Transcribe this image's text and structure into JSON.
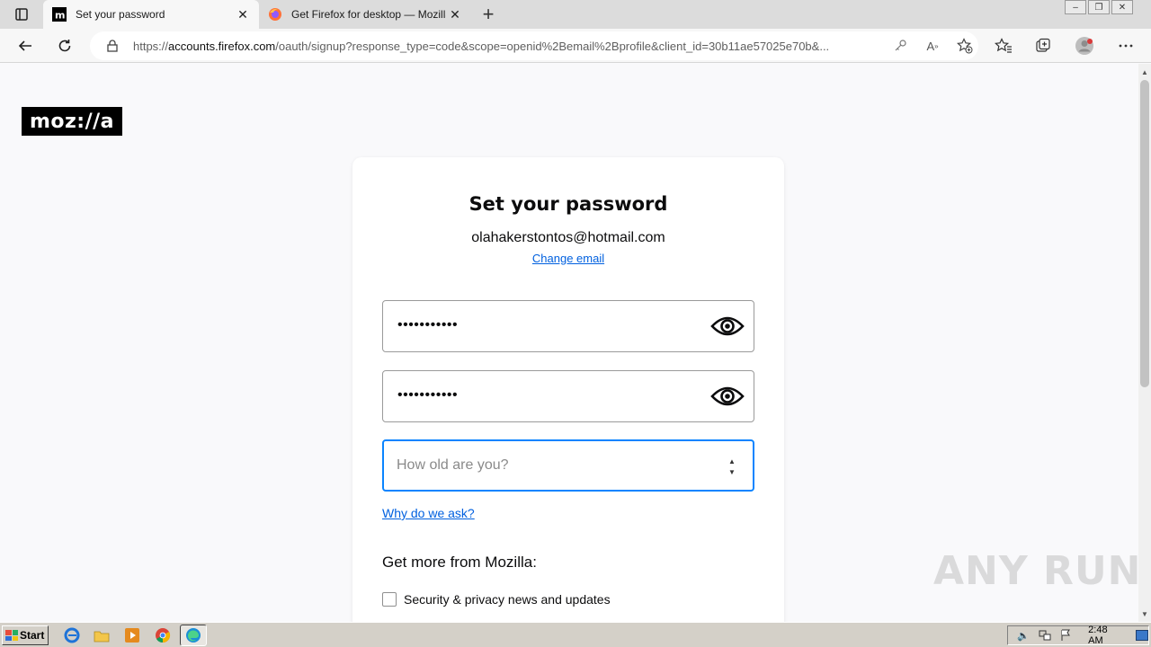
{
  "browser": {
    "tabs": [
      {
        "title": "Set your password",
        "favicon": "mozilla-m-icon",
        "active": true
      },
      {
        "title": "Get Firefox for desktop — Mozilla",
        "favicon": "firefox-icon",
        "active": false
      }
    ],
    "address": {
      "url_scheme": "https://",
      "url_host": "accounts.firefox.com",
      "url_path": "/oauth/signup?response_type=code&scope=openid%2Bemail%2Bprofile&client_id=30b11ae57025e70b&..."
    }
  },
  "page": {
    "logo_text": "moz://a",
    "heading": "Set your password",
    "email": "olahakerstontos@hotmail.com",
    "change_email": "Change email",
    "password_masked": "•••••••••••",
    "confirm_password_masked": "•••••••••••",
    "age_placeholder": "How old are you?",
    "age_value": "",
    "why_link": "Why do we ask?",
    "more_heading": "Get more from Mozilla:",
    "newsletter_label": "Security & privacy news and updates"
  },
  "taskbar": {
    "start_label": "Start",
    "clock": "2:48 AM"
  },
  "watermark": "ANY RUN",
  "colors": {
    "accent": "#0a84ff",
    "link": "#0060df",
    "text": "#0c0c0d",
    "page_bg": "#f9f9fb"
  }
}
